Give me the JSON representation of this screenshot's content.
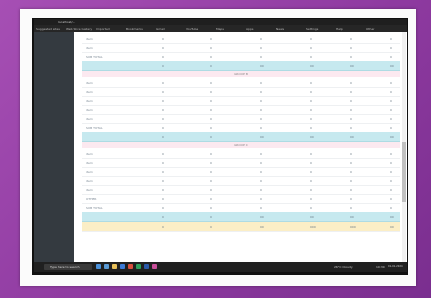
{
  "browser": {
    "title": "localhost/...",
    "bookmarks": [
      "Suggested sites",
      "Web Slice Gallery",
      "Imported",
      "Bookmarks",
      "Gmail",
      "YouTube",
      "Maps",
      "Apps",
      "News",
      "Settings",
      "Help",
      "Other"
    ]
  },
  "report": {
    "groups": [
      {
        "name": "",
        "rows": [
          {
            "label": "item",
            "values": [
              "0",
              "0",
              "0",
              "0",
              "0",
              "0",
              "0"
            ]
          },
          {
            "label": "item",
            "values": [
              "0",
              "0",
              "0",
              "0",
              "0",
              "0",
              "0"
            ]
          },
          {
            "label": "SUB TOTAL",
            "values": [
              "0",
              "0",
              "0",
              "0",
              "0",
              "0",
              "0"
            ]
          }
        ],
        "total": [
          "0",
          "0",
          "00",
          "00",
          "00",
          "00"
        ]
      },
      {
        "name": "GROUP B",
        "rows": [
          {
            "label": "item",
            "values": [
              "0",
              "0",
              "0",
              "0",
              "0",
              "0",
              "0"
            ]
          },
          {
            "label": "item",
            "values": [
              "0",
              "0",
              "0",
              "0",
              "0",
              "0",
              "0"
            ]
          },
          {
            "label": "item",
            "values": [
              "0",
              "0",
              "0",
              "0",
              "0",
              "0",
              "0"
            ]
          },
          {
            "label": "item",
            "values": [
              "0",
              "0",
              "0",
              "0",
              "0",
              "0",
              "0"
            ]
          },
          {
            "label": "item",
            "values": [
              "0",
              "0",
              "0",
              "0",
              "0",
              "0",
              "0"
            ]
          },
          {
            "label": "SUB TOTAL",
            "values": [
              "0",
              "0",
              "0",
              "0",
              "0",
              "0",
              "0"
            ]
          }
        ],
        "total": [
          "0",
          "0",
          "00",
          "00",
          "00",
          "00"
        ]
      },
      {
        "name": "GROUP C",
        "rows": [
          {
            "label": "item",
            "values": [
              "0",
              "0",
              "0",
              "0",
              "0",
              "0",
              "0"
            ]
          },
          {
            "label": "item",
            "values": [
              "0",
              "0",
              "0",
              "0",
              "0",
              "0",
              "0"
            ]
          },
          {
            "label": "item",
            "values": [
              "0",
              "0",
              "0",
              "0",
              "0",
              "0",
              "0"
            ]
          },
          {
            "label": "item",
            "values": [
              "0",
              "0",
              "0",
              "0",
              "0",
              "0",
              "0"
            ]
          },
          {
            "label": "item",
            "values": [
              "0",
              "0",
              "0",
              "0",
              "0",
              "0",
              "0"
            ]
          },
          {
            "label": "OTHER",
            "values": [
              "0",
              "0",
              "0",
              "0",
              "0",
              "0",
              "0"
            ]
          },
          {
            "label": "SUB TOTAL",
            "values": [
              "0",
              "0",
              "0",
              "0",
              "0",
              "0",
              "0"
            ]
          }
        ],
        "total": [
          "0",
          "0",
          "00",
          "00",
          "00",
          "00"
        ]
      }
    ],
    "grand_total": [
      "0",
      "0",
      "00",
      "000",
      "000",
      "00"
    ]
  },
  "taskbar": {
    "search_placeholder": "Type here to search",
    "weather": "26°C Cloudy",
    "time": "10:30",
    "date": "01-01-2024"
  },
  "colors": {
    "total_row": "#c6e9ef",
    "grand_total_row": "#fbeec6",
    "section_header": "#fce9f0"
  }
}
